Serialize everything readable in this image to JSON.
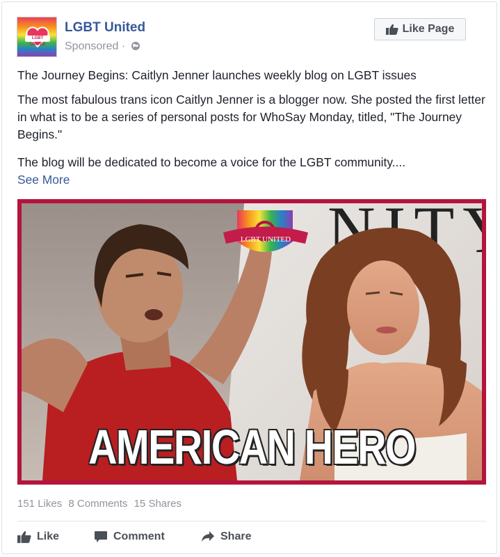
{
  "post": {
    "page_name": "LGBT United",
    "sponsored": "Sponsored ·",
    "like_page_label": "Like Page",
    "headline": "The Journey Begins: Caitlyn Jenner launches weekly blog on LGBT issues",
    "paragraph1": "The most fabulous trans icon Caitlyn Jenner is a blogger now. She posted the first letter in what is to be a series of personal posts for WhoSay Monday, titled, \"The Journey Begins.\"",
    "paragraph2": "The blog will be dedicated to become a voice for the LGBT community....",
    "see_more": "See More",
    "image": {
      "caption": "AMERICAN HERO",
      "badge": "LGBT UNITED",
      "masthead": "NITY"
    },
    "avatar_tag": "LGBT UNITED"
  },
  "stats": {
    "likes": "151 Likes",
    "comments": "8 Comments",
    "shares": "15 Shares"
  },
  "actions": {
    "like": "Like",
    "comment": "Comment",
    "share": "Share"
  },
  "icons": [
    "globe-icon",
    "thumbs-up-icon",
    "comment-icon",
    "share-icon"
  ],
  "colors": {
    "link": "#365899",
    "photo_border": "#b4143c",
    "muted": "#90949c"
  }
}
